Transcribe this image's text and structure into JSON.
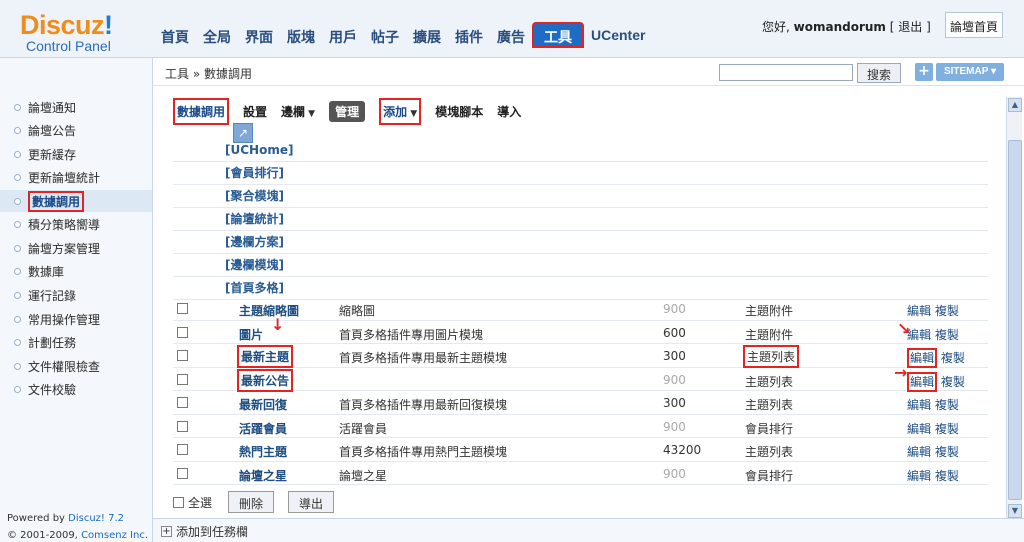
{
  "logo": {
    "main_a": "Discuz",
    "main_b": "!",
    "sub": "Control Panel"
  },
  "nav": {
    "items": [
      "首頁",
      "全局",
      "界面",
      "版塊",
      "用戶",
      "帖子",
      "擴展",
      "插件",
      "廣告",
      "工具",
      "UCenter"
    ],
    "active": "工具"
  },
  "user": {
    "greeting": "您好,",
    "name": "womandorum",
    "logout": "[ 退出 ]",
    "home": "論壇首頁"
  },
  "breadcrumb": "工具 » 數據調用",
  "search": {
    "value": "",
    "button": "搜索"
  },
  "sitemap": "SITEMAP",
  "sidebar": {
    "items": [
      "論壇通知",
      "論壇公告",
      "更新緩存",
      "更新論壇統計",
      "數據調用",
      "積分策略嚮導",
      "論壇方案管理",
      "數據庫",
      "運行記錄",
      "常用操作管理",
      "計劃任務",
      "文件權限檢查",
      "文件校驗"
    ],
    "active": "數據調用",
    "powered_a": "Powered by",
    "powered_b": "Discuz! 7.2",
    "copyright_a": "© 2001-2009,",
    "copyright_b": "Comsenz Inc."
  },
  "toolbar": {
    "title": "數據調用",
    "settings": "設置",
    "sidebar_label": "邊欄",
    "manage": "管理",
    "add": "添加",
    "preview_script": "模塊腳本",
    "import": "導入"
  },
  "categories": [
    "[UCHome]",
    "[會員排行]",
    "[聚合模塊]",
    "[論壇統計]",
    "[邊欄方案]",
    "[邊欄模塊]",
    "[首頁多格]"
  ],
  "rows": [
    {
      "name": "主題縮略圖",
      "desc": "縮略圖",
      "num": "900",
      "type": "主題附件",
      "edit": "編輯",
      "copy": "複製"
    },
    {
      "name": "圖片",
      "desc": "首頁多格插件專用圖片模塊",
      "num": "600",
      "type": "主題附件",
      "edit": "編輯",
      "copy": "複製"
    },
    {
      "name": "最新主題",
      "desc": "首頁多格插件專用最新主題模塊",
      "num": "300",
      "type": "主題列表",
      "edit": "編輯",
      "copy": "複製"
    },
    {
      "name": "最新公告",
      "desc": "",
      "num": "900",
      "type": "主題列表",
      "edit": "編輯",
      "copy": "複製"
    },
    {
      "name": "最新回復",
      "desc": "首頁多格插件專用最新回復模塊",
      "num": "300",
      "type": "主題列表",
      "edit": "編輯",
      "copy": "複製"
    },
    {
      "name": "活躍會員",
      "desc": "活躍會員",
      "num": "900",
      "type": "會員排行",
      "edit": "編輯",
      "copy": "複製"
    },
    {
      "name": "熱門主題",
      "desc": "首頁多格插件專用熱門主題模塊",
      "num": "43200",
      "type": "主題列表",
      "edit": "編輯",
      "copy": "複製"
    },
    {
      "name": "論壇之星",
      "desc": "論壇之星",
      "num": "900",
      "type": "會員排行",
      "edit": "編輯",
      "copy": "複製"
    }
  ],
  "footer": {
    "select_all": "全選",
    "delete": "刪除",
    "export": "導出"
  },
  "bottombar": {
    "add_task": "添加到任務欄"
  },
  "colors": {
    "accent": "#1e6cc4",
    "highlight": "#e52421",
    "logo_orange": "#f08c1c"
  }
}
